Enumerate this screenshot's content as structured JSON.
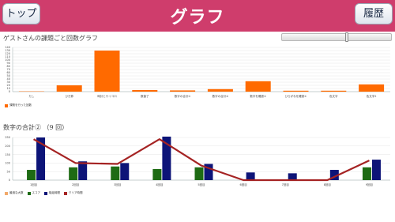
{
  "header": {
    "title": "グラフ",
    "back_label": "トップ",
    "history_label": "履歴",
    "color": "#cf3d6c"
  },
  "chart1": {
    "title": "ゲストさんの課題ごと回数グラフ"
  },
  "chart2": {
    "title": "数字の合計②",
    "count": "（9 回）"
  },
  "chart_data": [
    {
      "type": "bar",
      "categories": [
        "たし",
        "ひき算",
        "時計とサイコロ",
        "数値了",
        "数字の合計①",
        "数字の合計②",
        "数字を確認①",
        "ひらがなを確認①",
        "色文字",
        "色文字2"
      ],
      "series": [
        {
          "name": "課題を行った回数",
          "values": [
            1,
            20,
            130,
            5,
            4,
            8,
            33,
            3,
            3,
            23
          ],
          "color": "#ff6a00"
        }
      ],
      "ylim": [
        0,
        140
      ],
      "yticks": [
        0,
        10,
        20,
        30,
        40,
        50,
        60,
        70,
        80,
        90,
        100,
        110,
        120,
        130,
        140
      ],
      "legend": "bottom-left"
    },
    {
      "type": "bar",
      "categories": [
        "1回目",
        "2回目",
        "3回目",
        "4回目",
        "5回目",
        "6回目",
        "7回目",
        "8回目",
        "9回目"
      ],
      "series": [
        {
          "name": "最適な大数",
          "values": [
            0,
            0,
            0,
            0,
            0,
            0,
            0,
            0,
            0
          ],
          "color": "#f2a96a"
        },
        {
          "name": "スコア",
          "values": [
            60,
            75,
            80,
            65,
            75,
            0,
            0,
            0,
            75
          ],
          "color": "#1e6b14"
        },
        {
          "name": "取組時間",
          "values": [
            250,
            110,
            100,
            255,
            95,
            45,
            40,
            60,
            120
          ],
          "color": "#0d1478"
        },
        {
          "name": "クリア時間",
          "values": [
            240,
            100,
            95,
            240,
            85,
            0,
            0,
            0,
            115
          ],
          "color": "#a52323",
          "line": true
        }
      ],
      "ylim": [
        0,
        250
      ],
      "yticks": [
        0,
        50,
        100,
        150,
        200,
        250
      ],
      "legend": "bottom-left"
    }
  ]
}
